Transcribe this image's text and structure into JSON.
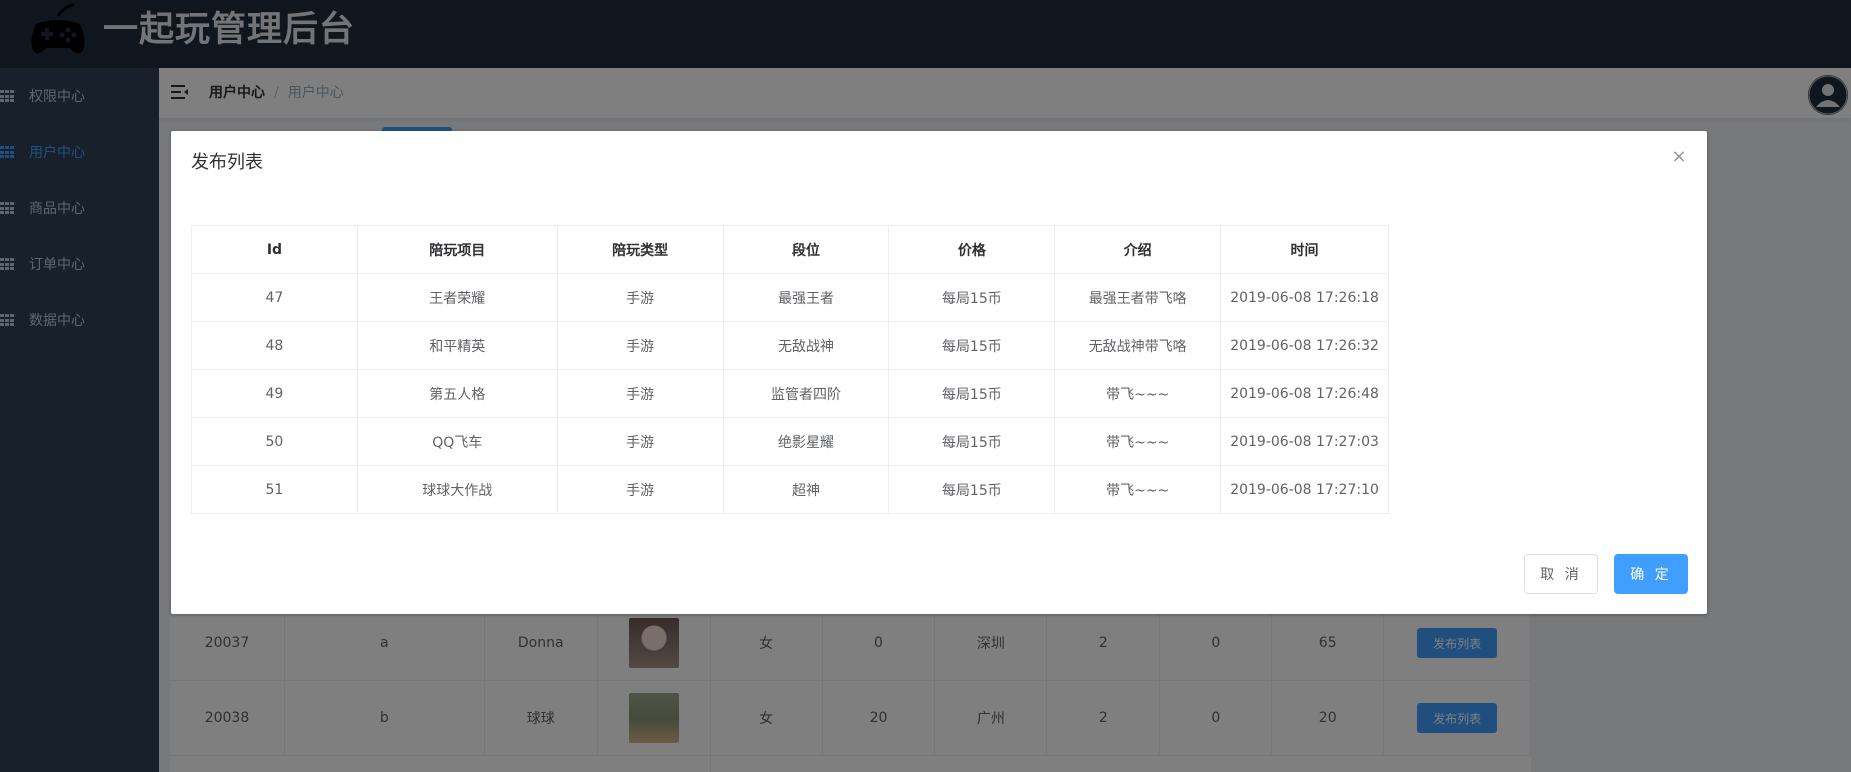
{
  "header": {
    "title": "一起玩管理后台"
  },
  "sidebar": {
    "items": [
      {
        "label": "权限中心",
        "active": false
      },
      {
        "label": "用户中心",
        "active": true
      },
      {
        "label": "商品中心",
        "active": false
      },
      {
        "label": "订单中心",
        "active": false
      },
      {
        "label": "数据中心",
        "active": false
      }
    ]
  },
  "navbar": {
    "breadcrumb": [
      "用户中心",
      "用户中心"
    ],
    "separator": "/"
  },
  "background_table": {
    "rows": [
      {
        "id": "20037",
        "account": "a",
        "nickname": "Donna",
        "gender": "女",
        "age": "0",
        "city": "深圳",
        "c1": "2",
        "c2": "0",
        "c3": "65",
        "action": "发布列表"
      },
      {
        "id": "20038",
        "account": "b",
        "nickname": "球球",
        "gender": "女",
        "age": "20",
        "city": "广州",
        "c1": "2",
        "c2": "0",
        "c3": "20",
        "action": "发布列表"
      }
    ]
  },
  "dialog": {
    "title": "发布列表",
    "close_icon": "×",
    "columns": [
      "Id",
      "陪玩项目",
      "陪玩类型",
      "段位",
      "价格",
      "介绍",
      "时间"
    ],
    "rows": [
      [
        "47",
        "王者荣耀",
        "手游",
        "最强王者",
        "每局15币",
        "最强王者带飞咯",
        "2019-06-08 17:26:18"
      ],
      [
        "48",
        "和平精英",
        "手游",
        "无敌战神",
        "每局15币",
        "无敌战神带飞咯",
        "2019-06-08 17:26:32"
      ],
      [
        "49",
        "第五人格",
        "手游",
        "监管者四阶",
        "每局15币",
        "带飞~~~",
        "2019-06-08 17:26:48"
      ],
      [
        "50",
        "QQ飞车",
        "手游",
        "绝影星耀",
        "每局15币",
        "带飞~~~",
        "2019-06-08 17:27:03"
      ],
      [
        "51",
        "球球大作战",
        "手游",
        "超神",
        "每局15币",
        "带飞~~~",
        "2019-06-08 17:27:10"
      ]
    ],
    "cancel_label": "取 消",
    "ok_label": "确 定"
  },
  "colors": {
    "header_bg": "#1f2d3d",
    "sidebar_bg": "#304156",
    "accent": "#409eff"
  }
}
